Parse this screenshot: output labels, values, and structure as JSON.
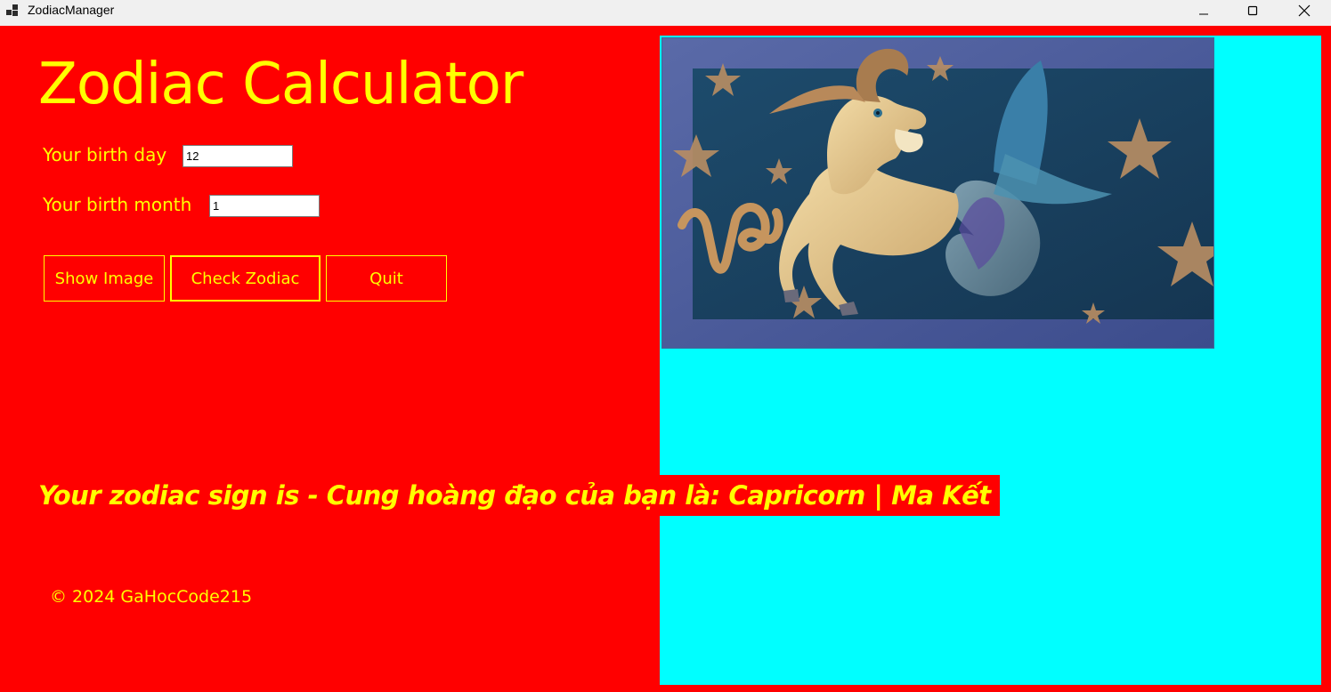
{
  "window": {
    "title": "ZodiacManager",
    "controls": {
      "minimize": "minimize-icon",
      "maximize": "maximize-icon",
      "close": "close-icon"
    }
  },
  "colors": {
    "background": "#ff0000",
    "text": "#ffff00",
    "panel": "#00ffff"
  },
  "form": {
    "heading": "Zodiac Calculator",
    "birth_day_label": "Your birth day",
    "birth_day_value": "12",
    "birth_month_label": "Your birth month",
    "birth_month_value": "1",
    "buttons": {
      "show_image": "Show Image",
      "check_zodiac": "Check Zodiac",
      "quit": "Quit"
    },
    "result": "Your zodiac sign is - Cung hoàng đạo của bạn là: Capricorn | Ma Kết",
    "copyright": "© 2024 GaHocCode215"
  },
  "image": {
    "subject": "capricorn-illustration"
  }
}
